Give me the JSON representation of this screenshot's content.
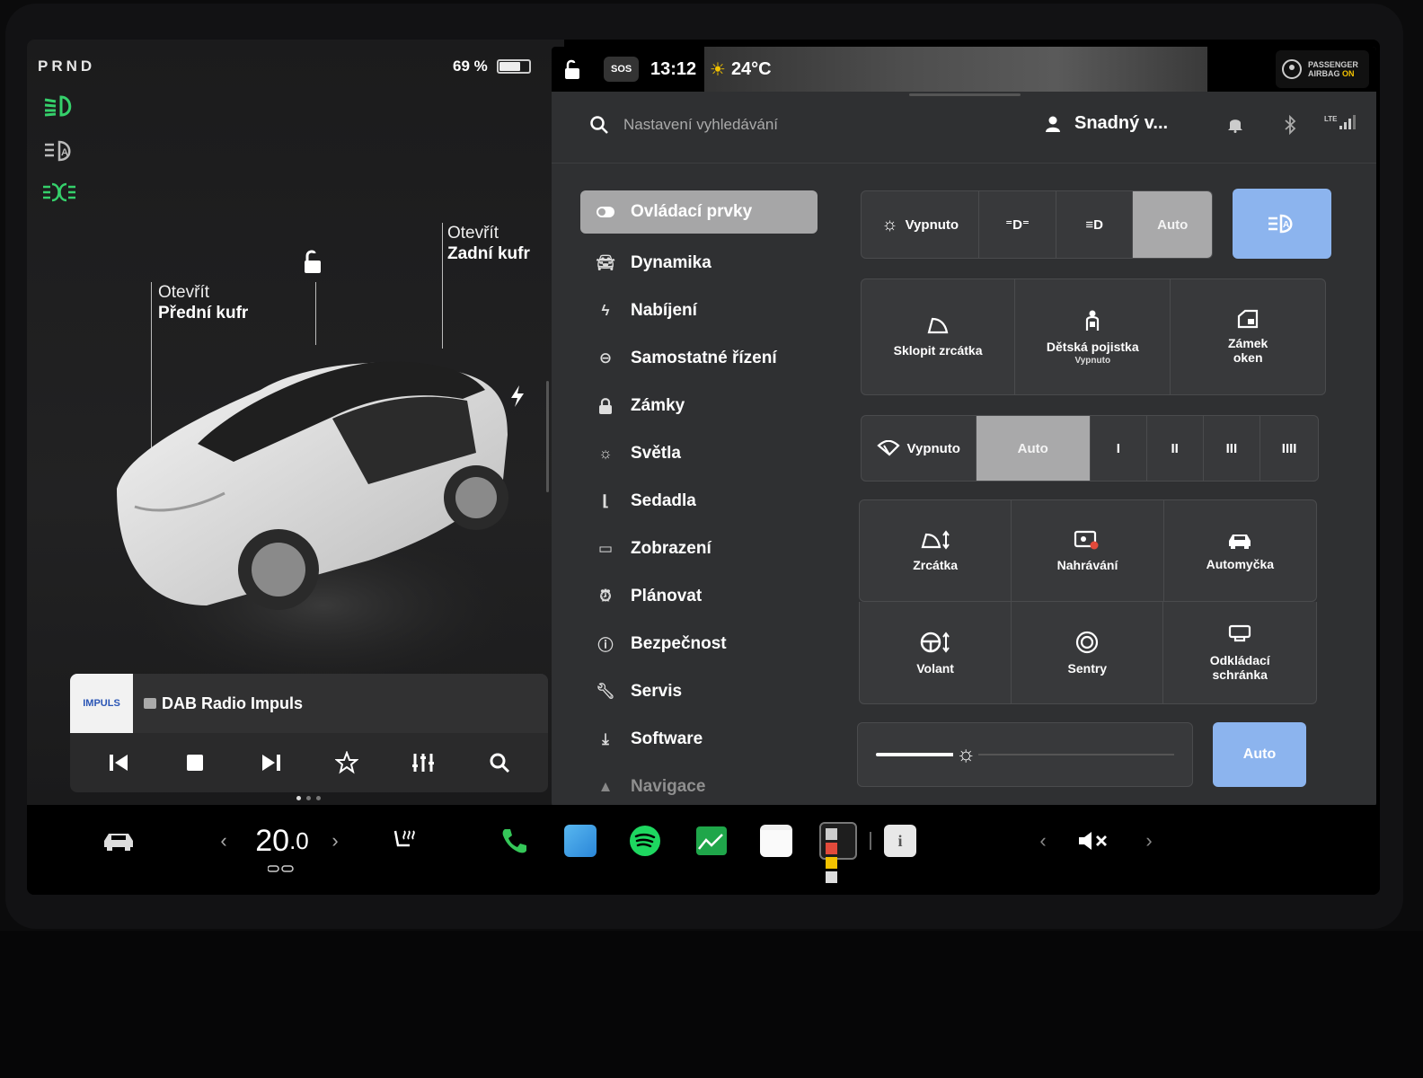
{
  "left": {
    "gear": "PRND",
    "battery_text": "69 %",
    "battery_level": 0.69,
    "front_trunk": {
      "line1": "Otevřít",
      "line2": "Přední kufr"
    },
    "rear_trunk": {
      "line1": "Otevřít",
      "line2": "Zadní kufr"
    }
  },
  "media": {
    "logo_text": "IMPULS",
    "station": "DAB Radio Impuls"
  },
  "status": {
    "sos": "SOS",
    "time": "13:12",
    "temperature": "24°C",
    "airbag_line1": "PASSENGER",
    "airbag_line2": "AIRBAG",
    "airbag_state": "ON"
  },
  "topbar": {
    "search_placeholder": "Nastavení vyhledávání",
    "profile": "Snadný v...",
    "network": "LTE"
  },
  "menu": [
    {
      "label": "Ovládací prvky",
      "icon": "toggle-icon"
    },
    {
      "label": "Dynamika",
      "icon": "car-icon"
    },
    {
      "label": "Nabíjení",
      "icon": "bolt-icon"
    },
    {
      "label": "Samostatné řízení",
      "icon": "steering-wheel-icon"
    },
    {
      "label": "Zámky",
      "icon": "lock-icon"
    },
    {
      "label": "Světla",
      "icon": "sun-icon"
    },
    {
      "label": "Sedadla",
      "icon": "seat-icon"
    },
    {
      "label": "Zobrazení",
      "icon": "display-icon"
    },
    {
      "label": "Plánovat",
      "icon": "alarm-icon"
    },
    {
      "label": "Bezpečnost",
      "icon": "alert-icon"
    },
    {
      "label": "Servis",
      "icon": "wrench-icon"
    },
    {
      "label": "Software",
      "icon": "download-icon"
    },
    {
      "label": "Navigace",
      "icon": "navigation-icon"
    }
  ],
  "lights": {
    "off_label": "Vypnuto",
    "auto_label": "Auto"
  },
  "tiles_row1": [
    {
      "label": "Sklopit zrcátka"
    },
    {
      "label": "Dětská pojistka",
      "sub": "Vypnuto"
    },
    {
      "label": "Zámek oken"
    }
  ],
  "wipers": {
    "off_label": "Vypnuto",
    "auto_label": "Auto",
    "speeds": [
      "I",
      "II",
      "III",
      "IIII"
    ]
  },
  "tiles_grid": [
    {
      "label": "Zrcátka"
    },
    {
      "label": "Nahrávání"
    },
    {
      "label": "Automyčka"
    },
    {
      "label": "Volant"
    },
    {
      "label": "Sentry"
    },
    {
      "label": "Odkládací schránka"
    }
  ],
  "brightness": {
    "auto_label": "Auto",
    "level": 0.3
  },
  "taskbar": {
    "temp_int": "20",
    "temp_dec": ".0"
  },
  "colors": {
    "headlight_green": "#35d06b",
    "accent_blue": "#8cb4ee",
    "airbag_yellow": "#f2c200"
  }
}
